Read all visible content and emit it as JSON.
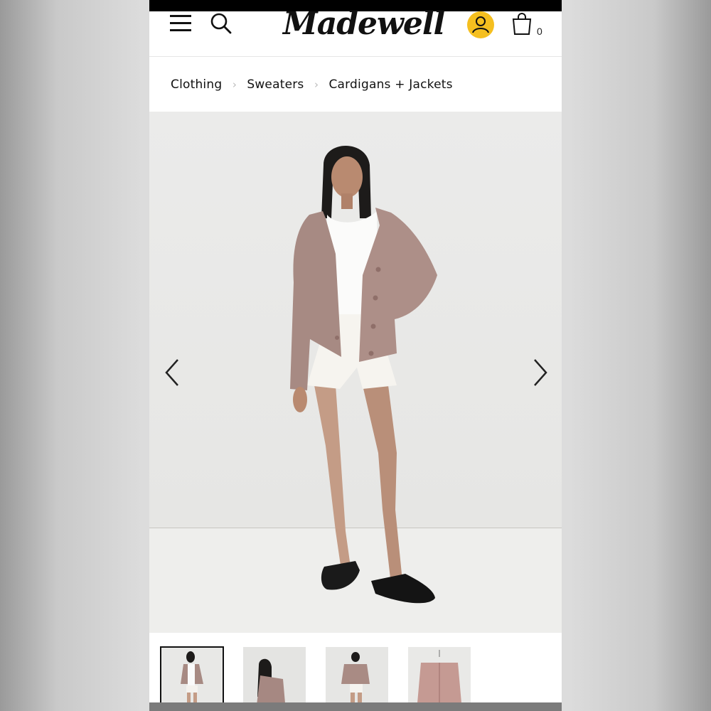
{
  "app": {
    "brand": "Madewell",
    "cart_count": "0"
  },
  "header": {
    "icons": [
      "menu-icon",
      "search-icon",
      "account-icon",
      "shopping-bag-icon"
    ],
    "account_icon_color": "#f5bf1f"
  },
  "breadcrumb": {
    "items": [
      "Clothing",
      "Sweaters",
      "Cardigans + Jackets"
    ]
  },
  "gallery": {
    "icons": [
      "chevron-left-icon",
      "chevron-right-icon"
    ],
    "thumbnail_count": 4,
    "selected_thumbnail": 1
  },
  "colors": {
    "cardigan": "#a88b84",
    "top": "#ffffff",
    "accent_yellow": "#f5bf1f"
  }
}
